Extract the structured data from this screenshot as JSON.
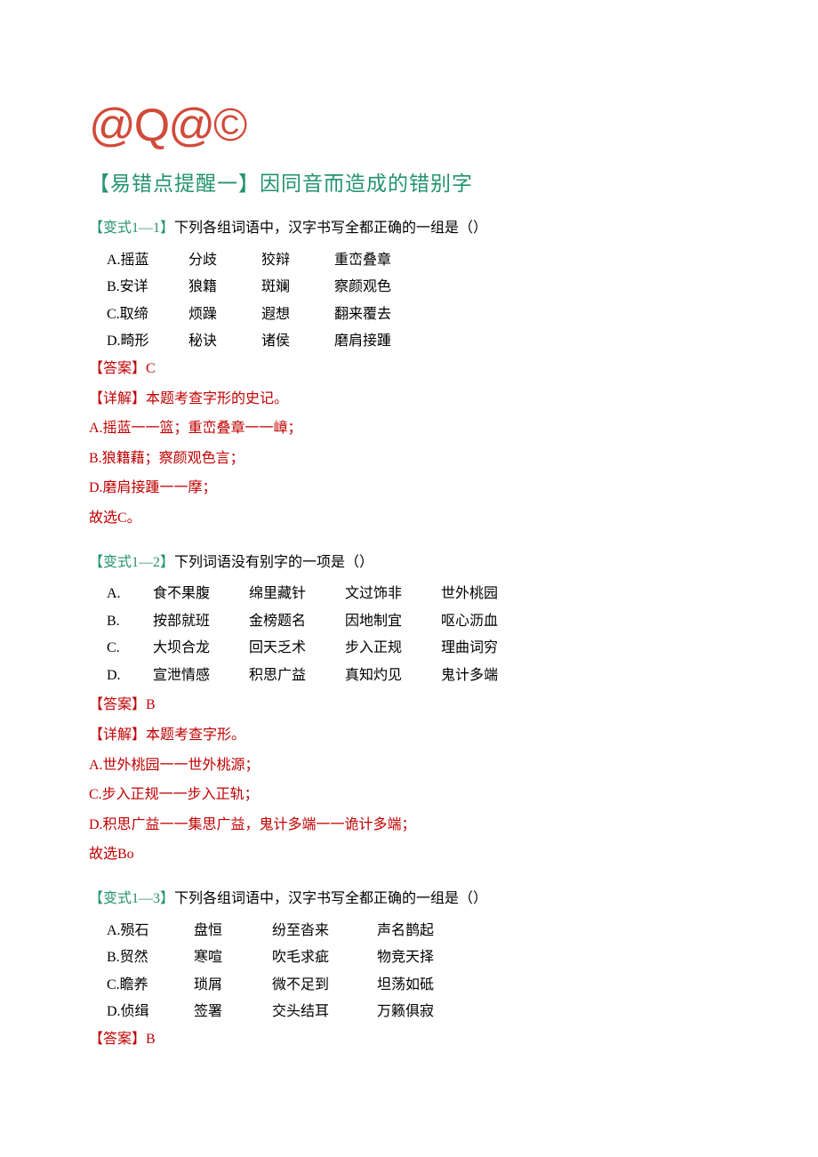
{
  "logo": "@Q@©",
  "heading": "【易错点提醒一】因同音而造成的错别字",
  "q1": {
    "label": "【变式1—1】",
    "stem": "下列各组词语中，汉字书写全都正确的一组是（）",
    "opts": [
      [
        "A.摇蓝",
        "分歧",
        "狡辩",
        "重峦叠章"
      ],
      [
        "B.安详",
        "狼籍",
        "斑斓",
        "察颜观色"
      ],
      [
        "C.取缔",
        "烦躁",
        "遐想",
        "翻来覆去"
      ],
      [
        "D.畸形",
        "秘诀",
        "诸侯",
        "磨肩接踵"
      ]
    ],
    "answer_label": "【答案】",
    "answer": "C",
    "detail_label": "【详解】",
    "detail_text": "本题考查字形的史记。",
    "expl": [
      "A.摇蓝一一篮；重峦叠章一一嶂；",
      "B.狼籍藉；察颜观色言；",
      "D.磨肩接踵一一摩；"
    ],
    "conclude": "故选C。"
  },
  "q2": {
    "label": "【变式1—2】",
    "stem": "下列词语没有别字的一项是（）",
    "opts": [
      [
        "A.",
        "食不果腹",
        "绵里藏针",
        "文过饰非",
        "世外桃园"
      ],
      [
        "B.",
        "按部就班",
        "金榜题名",
        "因地制宜",
        "呕心沥血"
      ],
      [
        "C.",
        "大坝合龙",
        "回天乏术",
        "步入正规",
        "理曲词穷"
      ],
      [
        "D.",
        "宣泄情感",
        "积思广益",
        "真知灼见",
        "鬼计多端"
      ]
    ],
    "answer_label": "【答案】",
    "answer": "B",
    "detail_label": "【详解】",
    "detail_text": "本题考查字形。",
    "expl": [
      "A.世外桃园一一世外桃源；",
      "C.步入正规一一步入正轨；",
      "D.积思广益一一集思广益，鬼计多端一一诡计多端；"
    ],
    "conclude": "故选Bo"
  },
  "q3": {
    "label": "【变式1—3】",
    "stem": "下列各组词语中，汉字书写全都正确的一组是（）",
    "opts": [
      [
        "A.殒石",
        "盘恒",
        "纷至沓来",
        "声名鹊起"
      ],
      [
        "B.贸然",
        "寒喧",
        "吹毛求疵",
        "物竞天择"
      ],
      [
        "C.瞻养",
        "琐屑",
        "微不足到",
        "坦荡如砥"
      ],
      [
        "D.侦缉",
        "签署",
        "交头结耳",
        "万籁俱寂"
      ]
    ],
    "answer_label": "【答案】",
    "answer": "B"
  }
}
